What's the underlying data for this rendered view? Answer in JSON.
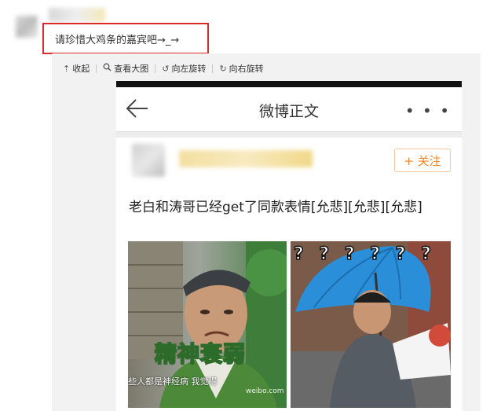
{
  "comment": {
    "text": "请珍惜大鸡条的嘉宾吧→_→"
  },
  "toolbar": {
    "collapse_label": "收起",
    "view_large_label": "查看大图",
    "rotate_left_label": "向左旋转",
    "rotate_right_label": "向右旋转"
  },
  "phone": {
    "nav_title": "微博正文",
    "more_glyph": "• • •",
    "follow_label": "+ 关注",
    "post_text": "老白和涛哥已经get了同款表情[允悲][允悲][允悲]",
    "image1_caption": "精神衰弱",
    "image1_subtitle": "些人都是神经病  我觉得",
    "image1_watermark": "weibo.com",
    "question_marks": "? ? ? ? ? ?"
  },
  "colors": {
    "highlight_border": "#d92b2b",
    "follow_orange": "#f08a2c",
    "umbrella_blue": "#2a8fd8"
  }
}
